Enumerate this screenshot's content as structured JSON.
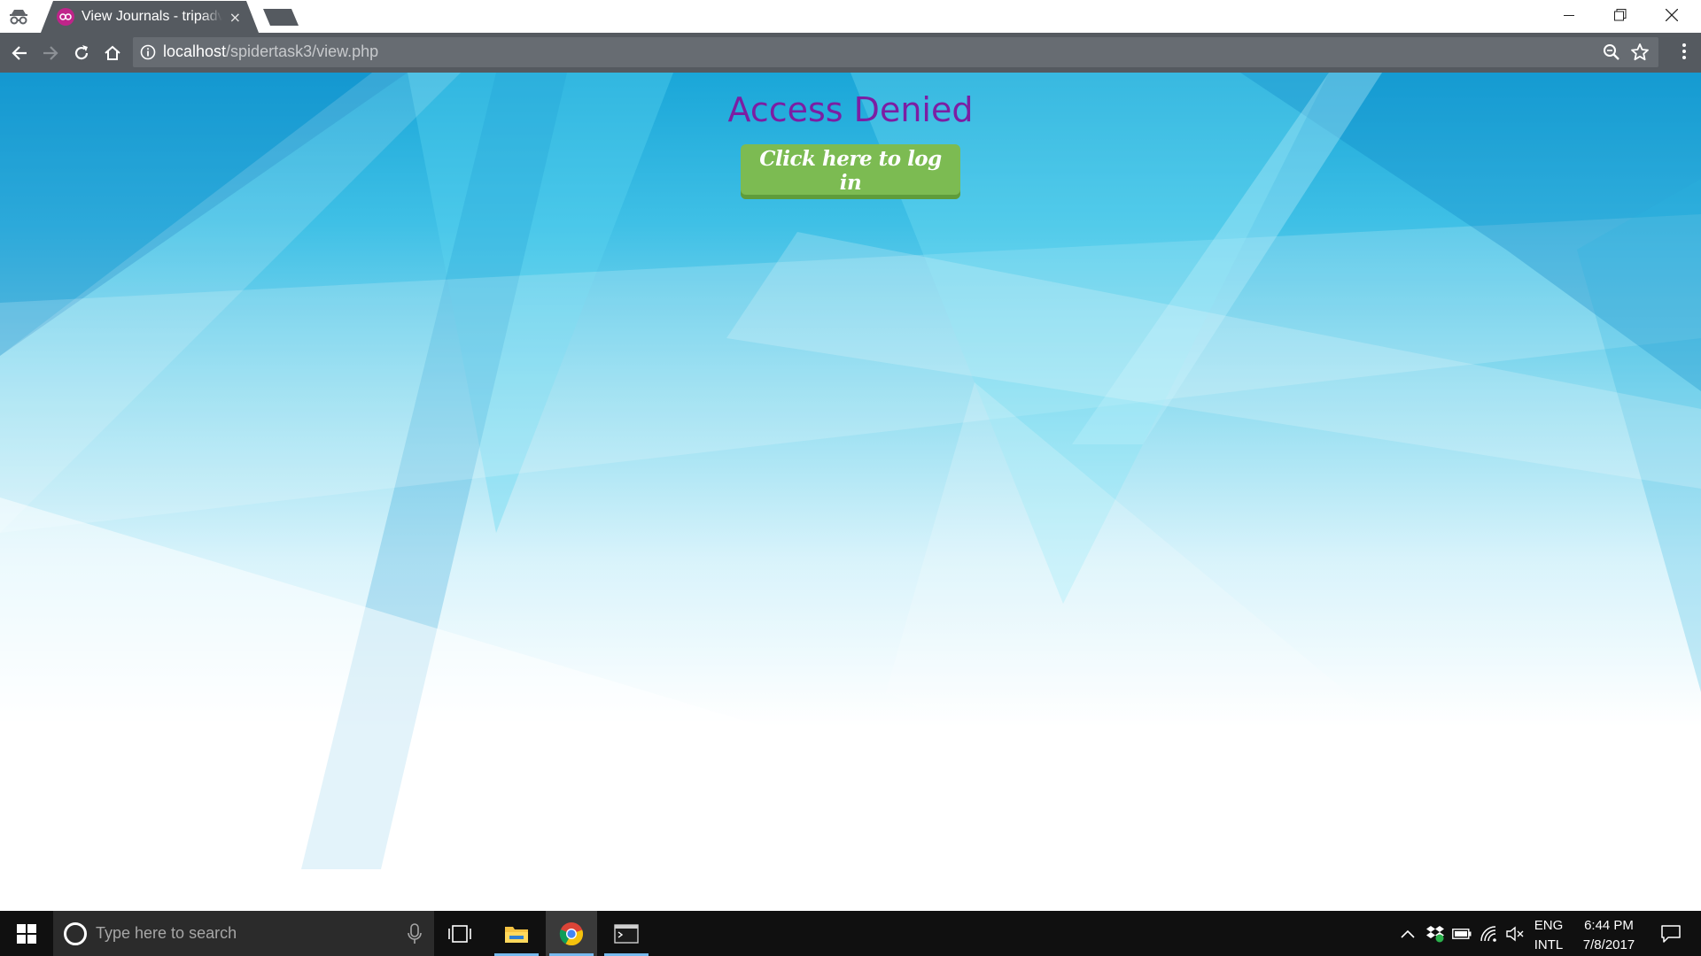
{
  "browser": {
    "tab": {
      "title": "View Journals - tripadvisor",
      "close_glyph": "×",
      "favicon": "tripadvisor-icon",
      "favicon_color": "#c0248a"
    },
    "address_bar": {
      "url_host": "localhost",
      "url_path": "/spidertask3/view.php"
    },
    "icons": {
      "incognito": "incognito-icon",
      "back": "back-arrow-icon",
      "forward": "forward-arrow-icon",
      "reload": "reload-icon",
      "home": "home-icon",
      "info": "info-icon",
      "zoom": "zoom-icon",
      "bookmark": "star-icon",
      "menu": "kebab-menu-icon",
      "minimize": "minimize-icon",
      "restore": "restore-icon",
      "close": "close-icon"
    },
    "chrome_color": "#555a60"
  },
  "page": {
    "heading": "Access Denied",
    "heading_color": "#7c1ea3",
    "login_button": "Click here to log in",
    "login_button_color": "#7cbb52"
  },
  "taskbar": {
    "search_placeholder": "Type here to search",
    "apps": [
      "task-view-icon",
      "file-explorer-icon",
      "chrome-icon",
      "terminal-icon"
    ],
    "tray": {
      "language": "ENG",
      "layout": "INTL",
      "time": "6:44 PM",
      "date": "7/8/2017"
    }
  }
}
